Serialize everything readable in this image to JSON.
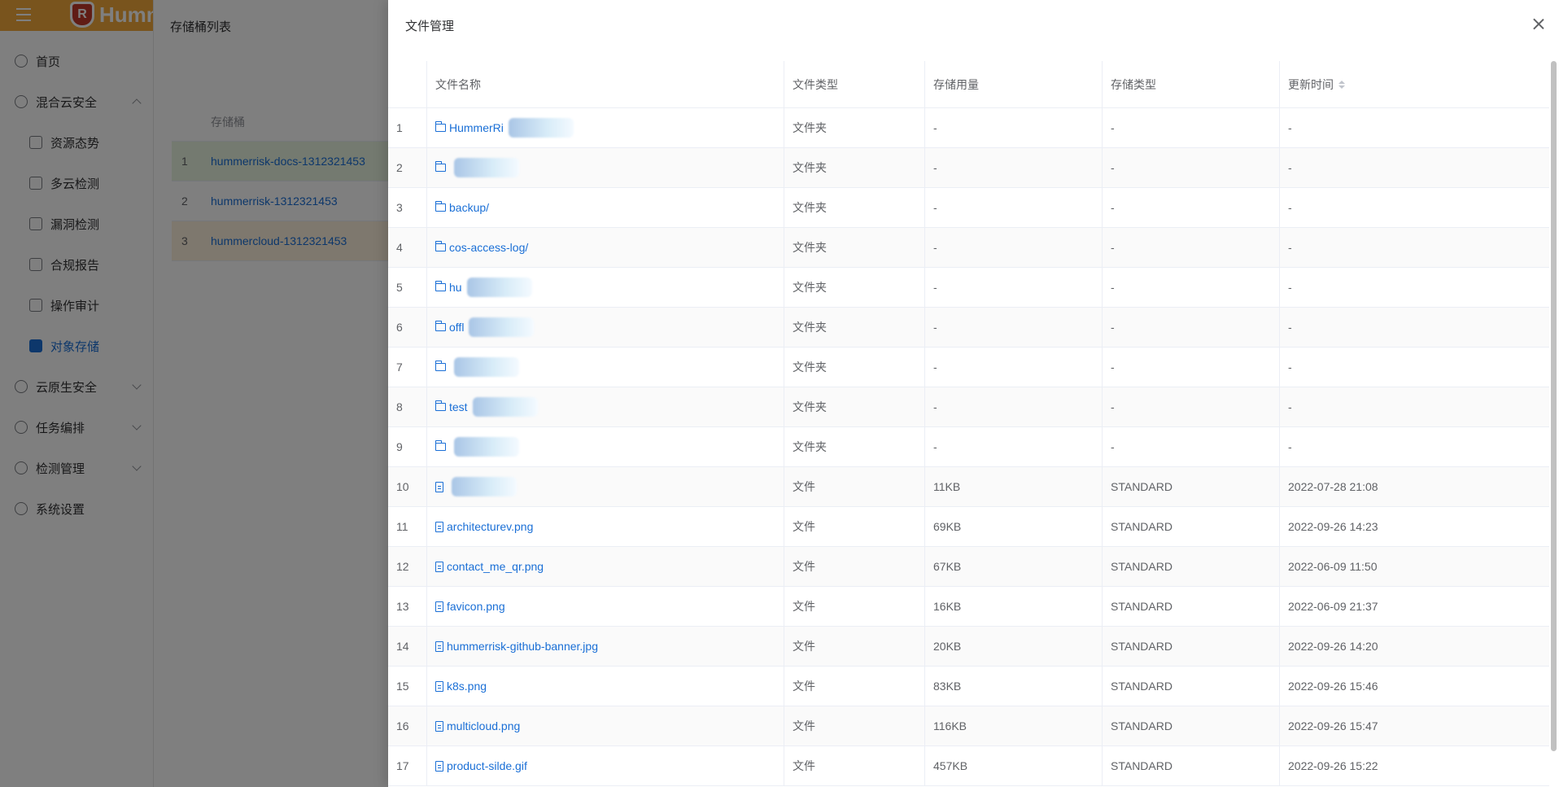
{
  "app": {
    "logo_text": "Humm",
    "logo_mark": "R"
  },
  "sidebar": {
    "items": [
      {
        "label": "首页",
        "icon": "dashboard-icon",
        "level": 0,
        "expandable": false
      },
      {
        "label": "混合云安全",
        "icon": "cloud-shield-icon",
        "level": 0,
        "expandable": true,
        "expanded": true
      },
      {
        "label": "资源态势",
        "icon": "chart-icon",
        "level": 1
      },
      {
        "label": "多云检测",
        "icon": "eye-icon",
        "level": 1
      },
      {
        "label": "漏洞检测",
        "icon": "bug-icon",
        "level": 1
      },
      {
        "label": "合规报告",
        "icon": "report-icon",
        "level": 1
      },
      {
        "label": "操作审计",
        "icon": "audit-icon",
        "level": 1
      },
      {
        "label": "对象存储",
        "icon": "storage-icon",
        "level": 1,
        "active": true
      },
      {
        "label": "云原生安全",
        "icon": "k8s-icon",
        "level": 0,
        "expandable": true
      },
      {
        "label": "任务编排",
        "icon": "list-icon",
        "level": 0,
        "expandable": true
      },
      {
        "label": "检测管理",
        "icon": "grid-icon",
        "level": 0,
        "expandable": true
      },
      {
        "label": "系统设置",
        "icon": "gear-icon",
        "level": 0
      }
    ]
  },
  "bucket_panel": {
    "title": "存储桶列表",
    "column": "存储桶",
    "rows": [
      {
        "index": "1",
        "name": "hummerrisk-docs-1312321453"
      },
      {
        "index": "2",
        "name": "hummerrisk-1312321453"
      },
      {
        "index": "3",
        "name": "hummercloud-1312321453"
      }
    ]
  },
  "drawer": {
    "title": "文件管理",
    "columns": {
      "name": "文件名称",
      "type": "文件类型",
      "size": "存储用量",
      "storage_class": "存储类型",
      "updated": "更新时间"
    },
    "rows": [
      {
        "index": "1",
        "kind": "folder",
        "name": "HummerRi",
        "blurred": true,
        "type": "文件夹",
        "size": "-",
        "storage_class": "-",
        "updated": "-"
      },
      {
        "index": "2",
        "kind": "folder",
        "name": "",
        "blurred": true,
        "type": "文件夹",
        "size": "-",
        "storage_class": "-",
        "updated": "-"
      },
      {
        "index": "3",
        "kind": "folder",
        "name": "backup/",
        "blurred": false,
        "type": "文件夹",
        "size": "-",
        "storage_class": "-",
        "updated": "-"
      },
      {
        "index": "4",
        "kind": "folder",
        "name": "cos-access-log/",
        "blurred": false,
        "type": "文件夹",
        "size": "-",
        "storage_class": "-",
        "updated": "-"
      },
      {
        "index": "5",
        "kind": "folder",
        "name": "hu",
        "blurred": true,
        "type": "文件夹",
        "size": "-",
        "storage_class": "-",
        "updated": "-"
      },
      {
        "index": "6",
        "kind": "folder",
        "name": "offl",
        "blurred": true,
        "type": "文件夹",
        "size": "-",
        "storage_class": "-",
        "updated": "-"
      },
      {
        "index": "7",
        "kind": "folder",
        "name": "",
        "blurred": true,
        "type": "文件夹",
        "size": "-",
        "storage_class": "-",
        "updated": "-"
      },
      {
        "index": "8",
        "kind": "folder",
        "name": "test",
        "blurred": true,
        "type": "文件夹",
        "size": "-",
        "storage_class": "-",
        "updated": "-"
      },
      {
        "index": "9",
        "kind": "folder",
        "name": "",
        "blurred": true,
        "type": "文件夹",
        "size": "-",
        "storage_class": "-",
        "updated": "-"
      },
      {
        "index": "10",
        "kind": "file",
        "name": "",
        "blurred": true,
        "type": "文件",
        "size": "11KB",
        "storage_class": "STANDARD",
        "updated": "2022-07-28 21:08"
      },
      {
        "index": "11",
        "kind": "file",
        "name": "architecturev.png",
        "blurred": false,
        "type": "文件",
        "size": "69KB",
        "storage_class": "STANDARD",
        "updated": "2022-09-26 14:23"
      },
      {
        "index": "12",
        "kind": "file",
        "name": "contact_me_qr.png",
        "blurred": false,
        "type": "文件",
        "size": "67KB",
        "storage_class": "STANDARD",
        "updated": "2022-06-09 11:50"
      },
      {
        "index": "13",
        "kind": "file",
        "name": "favicon.png",
        "blurred": false,
        "type": "文件",
        "size": "16KB",
        "storage_class": "STANDARD",
        "updated": "2022-06-09 21:37"
      },
      {
        "index": "14",
        "kind": "file",
        "name": "hummerrisk-github-banner.jpg",
        "blurred": false,
        "type": "文件",
        "size": "20KB",
        "storage_class": "STANDARD",
        "updated": "2022-09-26 14:20"
      },
      {
        "index": "15",
        "kind": "file",
        "name": "k8s.png",
        "blurred": false,
        "type": "文件",
        "size": "83KB",
        "storage_class": "STANDARD",
        "updated": "2022-09-26 15:46"
      },
      {
        "index": "16",
        "kind": "file",
        "name": "multicloud.png",
        "blurred": false,
        "type": "文件",
        "size": "116KB",
        "storage_class": "STANDARD",
        "updated": "2022-09-26 15:47"
      },
      {
        "index": "17",
        "kind": "file",
        "name": "product-silde.gif",
        "blurred": false,
        "type": "文件",
        "size": "457KB",
        "storage_class": "STANDARD",
        "updated": "2022-09-26 15:22"
      }
    ]
  },
  "colors": {
    "accent": "#1a6fd6",
    "header_bar": "#f2a93b",
    "overlay": "rgba(0,0,0,0.5)"
  }
}
